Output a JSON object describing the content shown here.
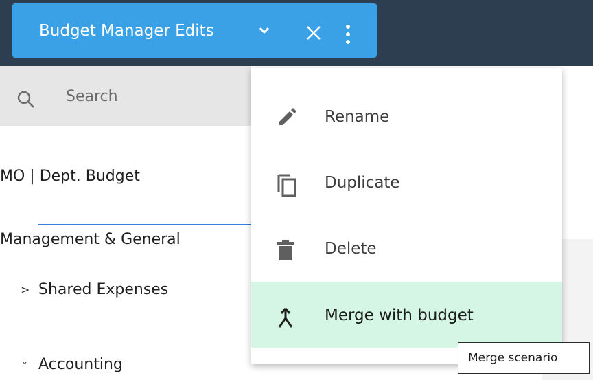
{
  "header": {
    "scenario_name": "Budget Manager Edits",
    "icons": [
      "chevron-down-icon",
      "close-icon",
      "more-vert-icon"
    ],
    "colors": {
      "topbar": "#2d3e50",
      "scenario_pill": "#3aa1e6"
    }
  },
  "sidebar": {
    "search_placeholder": "Search",
    "items": [
      {
        "label": "MO | Dept. Budget"
      },
      {
        "label": "Management & General"
      },
      {
        "label": "Shared Expenses",
        "caret": ">",
        "strikethrough": true
      },
      {
        "label": "Accounting",
        "caret": "ˇ"
      }
    ]
  },
  "menu": {
    "items": [
      {
        "label": "Rename",
        "icon": "edit-pencil-icon"
      },
      {
        "label": "Duplicate",
        "icon": "copy-icon"
      },
      {
        "label": "Delete",
        "icon": "trash-icon"
      },
      {
        "label": "Merge with budget",
        "icon": "merge-icon",
        "highlighted": true
      }
    ],
    "highlight_color": "#d5f5e5"
  },
  "tooltip": {
    "text": "Merge scenario"
  }
}
